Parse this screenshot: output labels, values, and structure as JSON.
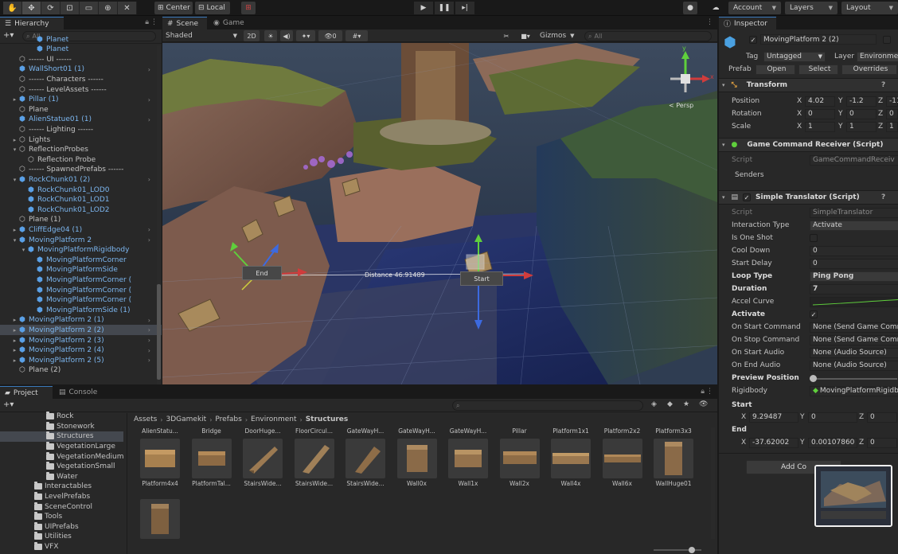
{
  "toolbar": {
    "pivot_center": "Center",
    "pivot_local": "Local",
    "account": "Account",
    "layers": "Layers",
    "layout": "Layout"
  },
  "hierarchy": {
    "tab": "Hierarchy",
    "search_placeholder": "All",
    "rows": [
      {
        "label": "Planet",
        "indent": 3,
        "type": "prefab",
        "arrow": "",
        "chev": false
      },
      {
        "label": "Planet",
        "indent": 3,
        "type": "prefab",
        "arrow": "",
        "chev": false
      },
      {
        "label": "------ UI ------",
        "indent": 1,
        "type": "plain",
        "arrow": "",
        "chev": false
      },
      {
        "label": "WallShort01 (1)",
        "indent": 1,
        "type": "prefab",
        "arrow": "",
        "chev": true
      },
      {
        "label": "------ Characters ------",
        "indent": 1,
        "type": "plain",
        "arrow": "",
        "chev": false
      },
      {
        "label": "------ LevelAssets ------",
        "indent": 1,
        "type": "plain",
        "arrow": "",
        "chev": false
      },
      {
        "label": "Pillar (1)",
        "indent": 1,
        "type": "prefab",
        "arrow": "▸",
        "chev": true
      },
      {
        "label": "Plane",
        "indent": 1,
        "type": "plain",
        "arrow": "",
        "chev": false
      },
      {
        "label": "AlienStatue01 (1)",
        "indent": 1,
        "type": "prefab",
        "arrow": "",
        "chev": true
      },
      {
        "label": "------ Lighting ------",
        "indent": 1,
        "type": "plain",
        "arrow": "",
        "chev": false
      },
      {
        "label": "Lights",
        "indent": 1,
        "type": "plain",
        "arrow": "▸",
        "chev": false
      },
      {
        "label": "ReflectionProbes",
        "indent": 1,
        "type": "plain",
        "arrow": "▾",
        "chev": false
      },
      {
        "label": "Reflection Probe",
        "indent": 2,
        "type": "plain",
        "arrow": "",
        "chev": false
      },
      {
        "label": "------ SpawnedPrefabs ------",
        "indent": 1,
        "type": "plain",
        "arrow": "",
        "chev": false
      },
      {
        "label": "RockChunk01 (2)",
        "indent": 1,
        "type": "prefab",
        "arrow": "▾",
        "chev": true
      },
      {
        "label": "RockChunk01_LOD0",
        "indent": 2,
        "type": "prefab",
        "arrow": "",
        "chev": false
      },
      {
        "label": "RockChunk01_LOD1",
        "indent": 2,
        "type": "prefab",
        "arrow": "",
        "chev": false
      },
      {
        "label": "RockChunk01_LOD2",
        "indent": 2,
        "type": "prefab",
        "arrow": "",
        "chev": false
      },
      {
        "label": "Plane (1)",
        "indent": 1,
        "type": "plain",
        "arrow": "",
        "chev": false
      },
      {
        "label": "CliffEdge04 (1)",
        "indent": 1,
        "type": "prefab",
        "arrow": "▸",
        "chev": true
      },
      {
        "label": "MovingPlatform 2",
        "indent": 1,
        "type": "prefab",
        "arrow": "▾",
        "chev": true
      },
      {
        "label": "MovingPlatformRigidbody",
        "indent": 2,
        "type": "prefab",
        "arrow": "▾",
        "chev": false
      },
      {
        "label": "MovingPlatformCorner",
        "indent": 3,
        "type": "prefab",
        "arrow": "",
        "chev": false
      },
      {
        "label": "MovingPlatformSide",
        "indent": 3,
        "type": "prefab",
        "arrow": "",
        "chev": false
      },
      {
        "label": "MovingPlatformCorner (",
        "indent": 3,
        "type": "prefab",
        "arrow": "",
        "chev": false
      },
      {
        "label": "MovingPlatformCorner (",
        "indent": 3,
        "type": "prefab",
        "arrow": "",
        "chev": false
      },
      {
        "label": "MovingPlatformCorner (",
        "indent": 3,
        "type": "prefab",
        "arrow": "",
        "chev": false
      },
      {
        "label": "MovingPlatformSide (1)",
        "indent": 3,
        "type": "prefab",
        "arrow": "",
        "chev": false
      },
      {
        "label": "MovingPlatform 2 (1)",
        "indent": 1,
        "type": "prefab",
        "arrow": "▸",
        "chev": true
      },
      {
        "label": "MovingPlatform 2 (2)",
        "indent": 1,
        "type": "prefab",
        "arrow": "▸",
        "chev": true,
        "selected": true
      },
      {
        "label": "MovingPlatform 2 (3)",
        "indent": 1,
        "type": "prefab",
        "arrow": "▸",
        "chev": true
      },
      {
        "label": "MovingPlatform 2 (4)",
        "indent": 1,
        "type": "prefab",
        "arrow": "▸",
        "chev": true
      },
      {
        "label": "MovingPlatform 2 (5)",
        "indent": 1,
        "type": "prefab",
        "arrow": "▸",
        "chev": true
      },
      {
        "label": "Plane (2)",
        "indent": 1,
        "type": "plain",
        "arrow": "",
        "chev": false
      }
    ]
  },
  "scene": {
    "tab_scene": "Scene",
    "tab_game": "Game",
    "shading": "Shaded",
    "mode_2d": "2D",
    "gizmos": "Gizmos",
    "search_placeholder": "All",
    "persp_label": "< Persp",
    "gizmo_y": "y",
    "gizmo_x": "x",
    "label_end": "End",
    "label_start": "Start",
    "distance": "Distance 46.91489"
  },
  "inspector": {
    "tab": "Inspector",
    "object_name": "MovingPlatform 2 (2)",
    "tag_label": "Tag",
    "tag_value": "Untagged",
    "layer_label": "Layer",
    "layer_value": "Environment",
    "prefab_label": "Prefab",
    "prefab_open": "Open",
    "prefab_select": "Select",
    "prefab_overrides": "Overrides",
    "transform": {
      "title": "Transform",
      "position_label": "Position",
      "rotation_label": "Rotation",
      "scale_label": "Scale",
      "position": {
        "x": "4.02",
        "y": "-1.2",
        "z": "-11"
      },
      "rotation": {
        "x": "0",
        "y": "0",
        "z": "0"
      },
      "scale": {
        "x": "1",
        "y": "1",
        "z": "1"
      }
    },
    "gcr": {
      "title": "Game Command Receiver (Script)",
      "script_label": "Script",
      "script_value": "GameCommandReceiv",
      "senders_label": "Senders"
    },
    "st": {
      "title": "Simple Translator (Script)",
      "fields": [
        {
          "label": "Script",
          "value": "SimpleTranslator",
          "kind": "dim"
        },
        {
          "label": "Interaction Type",
          "value": "Activate",
          "kind": "dd"
        },
        {
          "label": "Is One Shot",
          "value": "",
          "kind": "check"
        },
        {
          "label": "Cool Down",
          "value": "0",
          "kind": "field"
        },
        {
          "label": "Start Delay",
          "value": "0",
          "kind": "field"
        },
        {
          "label": "Loop Type",
          "value": "Ping Pong",
          "kind": "dd",
          "bold": true
        },
        {
          "label": "Duration",
          "value": "7",
          "kind": "field",
          "bold": true
        },
        {
          "label": "Accel Curve",
          "value": "",
          "kind": "curve"
        },
        {
          "label": "Activate",
          "value": "✓",
          "kind": "checked",
          "bold": true
        },
        {
          "label": "On Start Command",
          "value": "None (Send Game Comm",
          "kind": "field"
        },
        {
          "label": "On Stop Command",
          "value": "None (Send Game Comm",
          "kind": "field"
        },
        {
          "label": "On Start Audio",
          "value": "None (Audio Source)",
          "kind": "field"
        },
        {
          "label": "On End Audio",
          "value": "None (Audio Source)",
          "kind": "field"
        },
        {
          "label": "Preview Position",
          "value": "",
          "kind": "slider",
          "bold": true
        },
        {
          "label": "Rigidbody",
          "value": "MovingPlatformRigidb",
          "kind": "obj"
        }
      ],
      "start_label": "Start",
      "start": {
        "x": "9.29487",
        "y": "0",
        "z": "0"
      },
      "end_label": "End",
      "end": {
        "x": "-37.62002",
        "y": "0.00107860",
        "z": "0"
      }
    },
    "add_component": "Add Co"
  },
  "project": {
    "tab_project": "Project",
    "tab_console": "Console",
    "tree": [
      {
        "label": "Rock",
        "indent": 4
      },
      {
        "label": "Stonework",
        "indent": 4
      },
      {
        "label": "Structures",
        "indent": 4,
        "selected": true
      },
      {
        "label": "VegetationLarge",
        "indent": 4
      },
      {
        "label": "VegetationMedium",
        "indent": 4
      },
      {
        "label": "VegetationSmall",
        "indent": 4
      },
      {
        "label": "Water",
        "indent": 4
      },
      {
        "label": "Interactables",
        "indent": 3
      },
      {
        "label": "LevelPrefabs",
        "indent": 3
      },
      {
        "label": "SceneControl",
        "indent": 3
      },
      {
        "label": "Tools",
        "indent": 3
      },
      {
        "label": "UIPrefabs",
        "indent": 3
      },
      {
        "label": "Utilities",
        "indent": 3
      },
      {
        "label": "VFX",
        "indent": 3
      }
    ],
    "breadcrumb": [
      "Assets",
      "3DGamekit",
      "Prefabs",
      "Environment",
      "Structures"
    ],
    "top_row": [
      "AlienStatu...",
      "Bridge",
      "DoorHuge...",
      "FloorCircul...",
      "GateWayH...",
      "GateWayH...",
      "GateWayH...",
      "Pillar",
      "Platform1x1",
      "Platform2x2",
      "Platform3x3"
    ],
    "assets": [
      "Platform4x4",
      "PlatformTal...",
      "StairsWide...",
      "StairsWide...",
      "StairsWide...",
      "Wall0x",
      "Wall1x",
      "Wall2x",
      "Wall4x",
      "Wall6x",
      "WallHuge01",
      ""
    ]
  }
}
